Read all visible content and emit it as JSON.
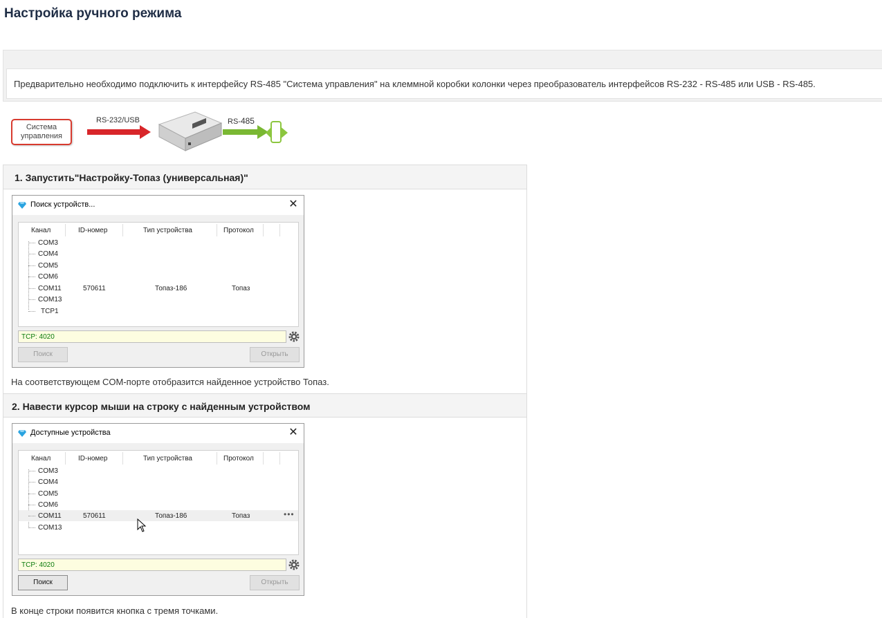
{
  "page": {
    "title": "Настройка ручного режима",
    "notice": "Предварительно необходимо подключить к интерфейсу RS-485 \"Система управления\" на клеммной коробки колонки через преобразователь интерфейсов RS-232 - RS-485 или USB - RS-485."
  },
  "scheme": {
    "system_label": "Система управления",
    "link1_label": "RS-232/USB",
    "link2_prefix": "RS-",
    "link2_number": "485",
    "colors": {
      "red_arrow": "#d8262a",
      "green_arrow": "#7ab833"
    }
  },
  "steps": [
    {
      "heading": "1. Запустить\"Настройку-Топаз (универсальная)\"",
      "dialog": {
        "title": "Поиск устройств...",
        "columns": [
          "Канал",
          "ID-номер",
          "Тип устройства",
          "Протокол"
        ],
        "rows": [
          {
            "channel": "COM3"
          },
          {
            "channel": "COM4"
          },
          {
            "channel": "COM5"
          },
          {
            "channel": "COM6"
          },
          {
            "channel": "COM11",
            "id": "570611",
            "type": "Топаз-186",
            "protocol": "Топаз"
          },
          {
            "channel": "COM13"
          },
          {
            "channel": "TCP1"
          }
        ],
        "tcp_value": "TCP: 4020",
        "search_button": "Поиск",
        "open_button": "Открыть"
      },
      "caption": "На соответствующем COM-порте отобразится найденное устройство Топаз."
    },
    {
      "heading": "2. Навести курсор мыши на строку с найденным устройством",
      "dialog": {
        "title": "Доступные устройства",
        "columns": [
          "Канал",
          "ID-номер",
          "Тип устройства",
          "Протокол"
        ],
        "rows": [
          {
            "channel": "COM3"
          },
          {
            "channel": "COM4"
          },
          {
            "channel": "COM5"
          },
          {
            "channel": "COM6"
          },
          {
            "channel": "COM11",
            "id": "570611",
            "type": "Топаз-186",
            "protocol": "Топаз",
            "more": "•••"
          },
          {
            "channel": "COM13"
          }
        ],
        "tcp_value": "TCP: 4020",
        "search_button": "Поиск",
        "open_button": "Открыть"
      },
      "caption": "В конце строки появится кнопка с тремя точками."
    }
  ]
}
